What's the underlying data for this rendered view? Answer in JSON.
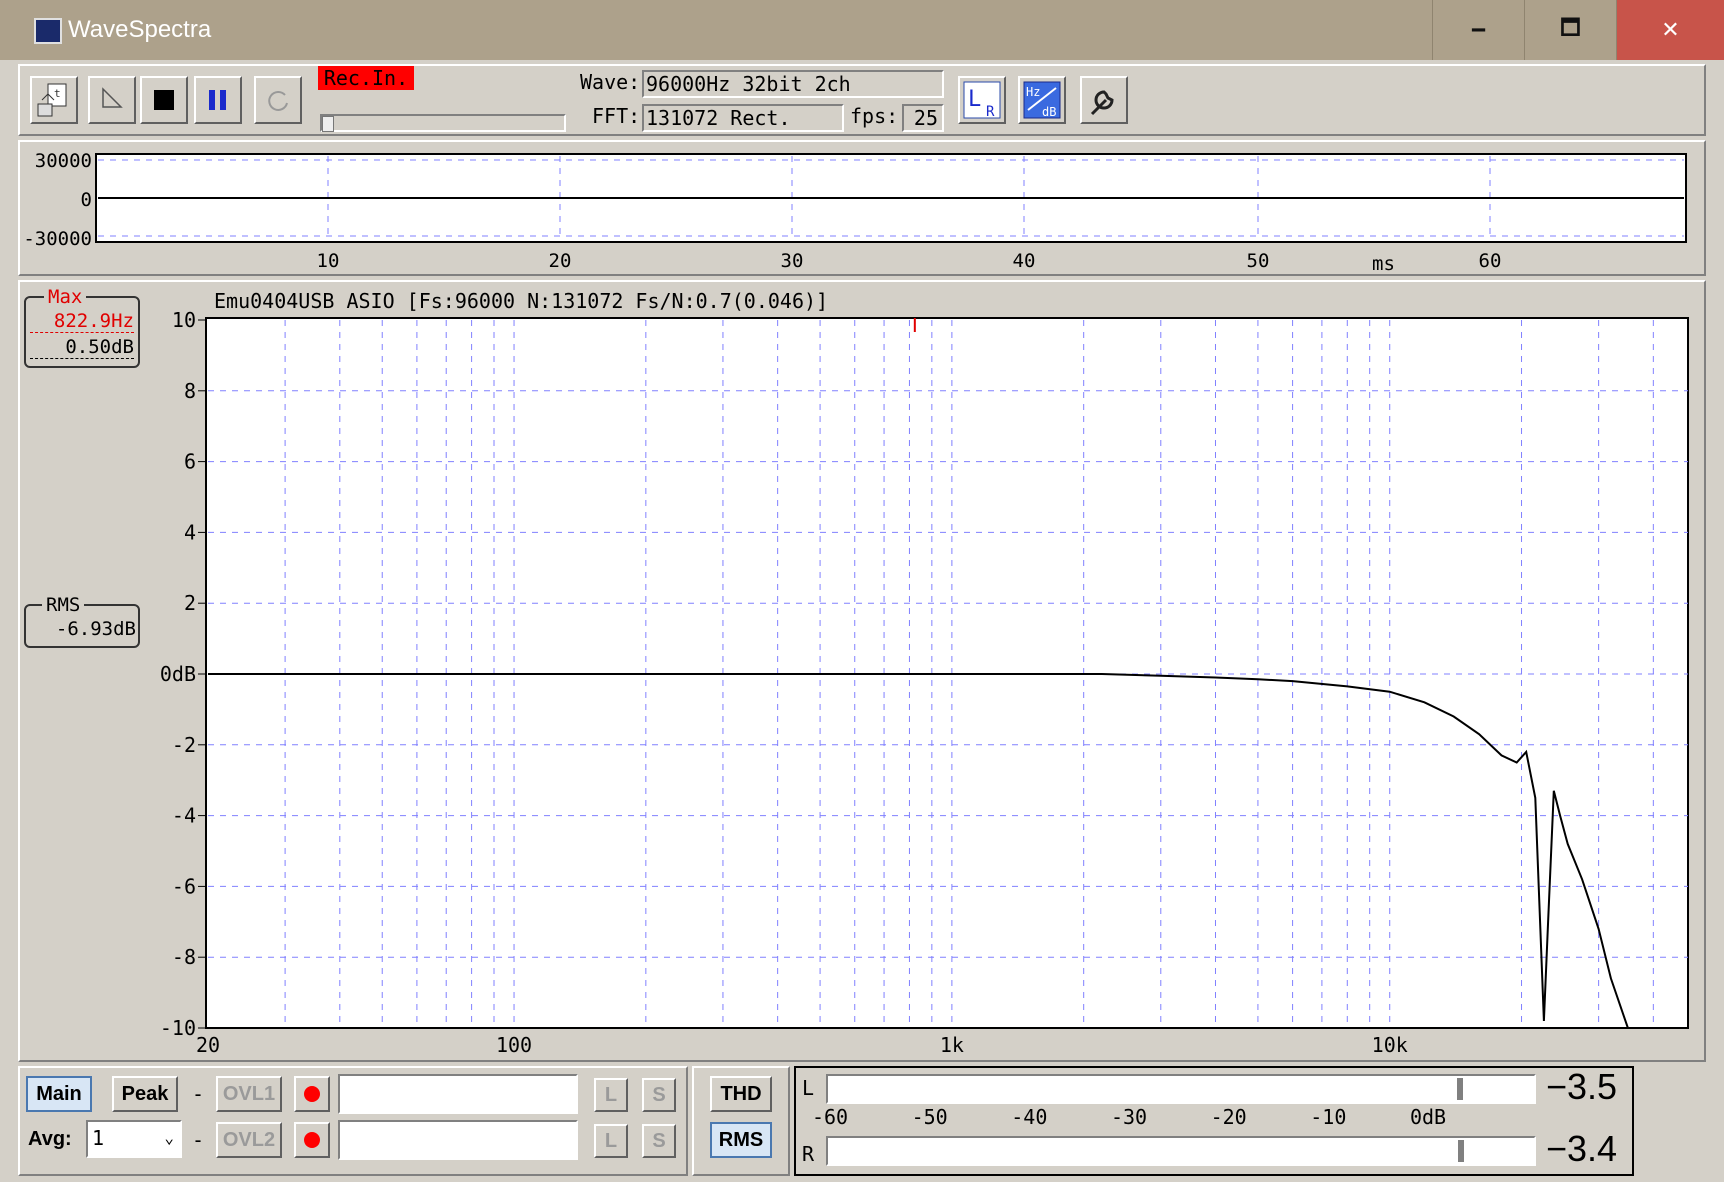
{
  "window": {
    "title": "WaveSpectra",
    "minimize": "🗕",
    "maximize": "🗖",
    "close": "✕"
  },
  "toolbar": {
    "rec_in": "Rec.In.",
    "wave_label": "Wave:",
    "wave_value": "96000Hz 32bit 2ch",
    "fft_label": "FFT:",
    "fft_value": "131072 Rect.",
    "fps_label": "fps:",
    "fps_value": "25",
    "icons": [
      "open-file-icon",
      "play-icon",
      "stop-icon",
      "pause-icon",
      "refresh-icon",
      "lr-channel-icon",
      "hz-db-scale-icon",
      "settings-wrench-icon"
    ],
    "lr_L": "L",
    "lr_R": "R",
    "hz_text": "Hz",
    "db_text": "dB"
  },
  "waveform": {
    "y_labels": [
      "30000",
      "0",
      "-30000"
    ],
    "x_labels": [
      "10",
      "20",
      "30",
      "40",
      "50",
      "60"
    ],
    "x_unit": "ms"
  },
  "spectrum": {
    "header": "Emu0404USB ASIO  [Fs:96000 N:131072 Fs/N:0.7(0.046)]",
    "max_box": {
      "title": "Max",
      "freq": "822.9Hz",
      "level": "0.50dB"
    },
    "rms_box": {
      "title": "RMS",
      "level": "-6.93dB"
    },
    "y_labels": [
      "10",
      "8",
      "6",
      "4",
      "2",
      "0dB",
      "-2",
      "-4",
      "-6",
      "-8",
      "-10"
    ],
    "x_labels": [
      "20",
      "100",
      "1k",
      "10k"
    ]
  },
  "chart_data": {
    "type": "line",
    "title": "Emu0404USB ASIO  [Fs:96000 N:131072 Fs/N:0.7(0.046)]",
    "xscale": "log",
    "xlim": [
      20,
      48000
    ],
    "ylim": [
      -10,
      10
    ],
    "grid": true,
    "series": [
      {
        "x": [
          20,
          100,
          1000,
          2200,
          3000,
          4000,
          5000,
          6000,
          8000,
          10000,
          12000,
          14000,
          16000,
          18000,
          19500,
          20500,
          21500,
          22500,
          23000,
          23700,
          24500,
          25500,
          27500,
          30000,
          32000,
          35000
        ],
        "y": [
          0,
          0,
          0,
          0,
          -0.05,
          -0.1,
          -0.15,
          -0.2,
          -0.35,
          -0.5,
          -0.8,
          -1.2,
          -1.7,
          -2.3,
          -2.5,
          -2.2,
          -3.5,
          -9.8,
          -7.0,
          -3.3,
          -4.0,
          -4.8,
          -5.8,
          -7.2,
          -8.6,
          -10
        ]
      }
    ],
    "max_marker": {
      "x": 822.9,
      "y": 0.5
    }
  },
  "bottom": {
    "main": "Main",
    "peak": "Peak",
    "dash1": "-",
    "dash2": "-",
    "ovl1": "OVL1",
    "ovl2": "OVL2",
    "avg_label": "Avg:",
    "avg_value": "1",
    "l1": "L",
    "s1": "S",
    "l2": "L",
    "s2": "S",
    "thd": "THD",
    "rms": "RMS"
  },
  "meter": {
    "L_label": "L",
    "R_label": "R",
    "L_value": "−3.5",
    "R_value": "−3.4",
    "L_level_db": -3.5,
    "R_level_db": -3.4,
    "scale": [
      "-60",
      "-50",
      "-40",
      "-30",
      "-20",
      "-10",
      "0dB"
    ]
  }
}
